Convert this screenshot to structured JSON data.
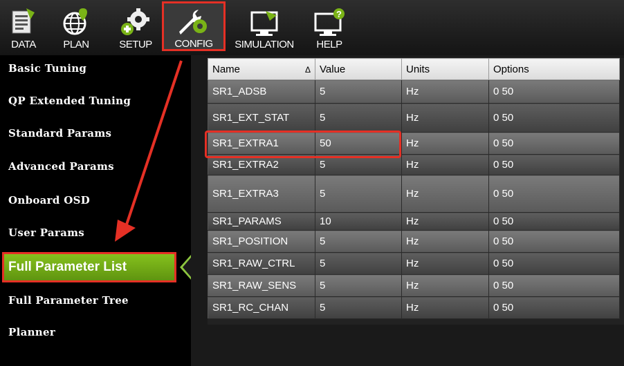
{
  "toolbar": {
    "buttons": [
      {
        "label": "DATA"
      },
      {
        "label": "PLAN"
      },
      {
        "label": "SETUP"
      },
      {
        "label": "CONFIG"
      },
      {
        "label": "SIMULATION"
      },
      {
        "label": "HELP"
      }
    ],
    "active": "CONFIG"
  },
  "sidebar": {
    "items": [
      {
        "label": "Basic Tuning"
      },
      {
        "label": "QP Extended Tuning"
      },
      {
        "label": "Standard Params"
      },
      {
        "label": "Advanced Params"
      },
      {
        "label": "Onboard OSD"
      },
      {
        "label": "User Params"
      },
      {
        "label": "Full Parameter List"
      },
      {
        "label": "Full Parameter Tree"
      },
      {
        "label": "Planner"
      }
    ],
    "selected": "Full Parameter List"
  },
  "table": {
    "columns": [
      "Name",
      "Value",
      "Units",
      "Options"
    ],
    "sort_indicator": "Δ",
    "rows": [
      {
        "name": "SR1_ADSB",
        "value": "5",
        "units": "Hz",
        "options": "0 50"
      },
      {
        "name": "SR1_EXT_STAT",
        "value": "5",
        "units": "Hz",
        "options": "0 50"
      },
      {
        "name": "SR1_EXTRA1",
        "value": "50",
        "units": "Hz",
        "options": "0 50"
      },
      {
        "name": "SR1_EXTRA2",
        "value": "5",
        "units": "Hz",
        "options": "0 50"
      },
      {
        "name": "SR1_EXTRA3",
        "value": "5",
        "units": "Hz",
        "options": "0 50"
      },
      {
        "name": "SR1_PARAMS",
        "value": "10",
        "units": "Hz",
        "options": "0 50"
      },
      {
        "name": "SR1_POSITION",
        "value": "5",
        "units": "Hz",
        "options": "0 50"
      },
      {
        "name": "SR1_RAW_CTRL",
        "value": "5",
        "units": "Hz",
        "options": "0 50"
      },
      {
        "name": "SR1_RAW_SENS",
        "value": "5",
        "units": "Hz",
        "options": "0 50"
      },
      {
        "name": "SR1_RC_CHAN",
        "value": "5",
        "units": "Hz",
        "options": "0 50"
      }
    ],
    "highlighted_row": "SR1_EXTRA1"
  },
  "colors": {
    "accent_green": "#7ab317",
    "annotation_red": "#e53025"
  }
}
